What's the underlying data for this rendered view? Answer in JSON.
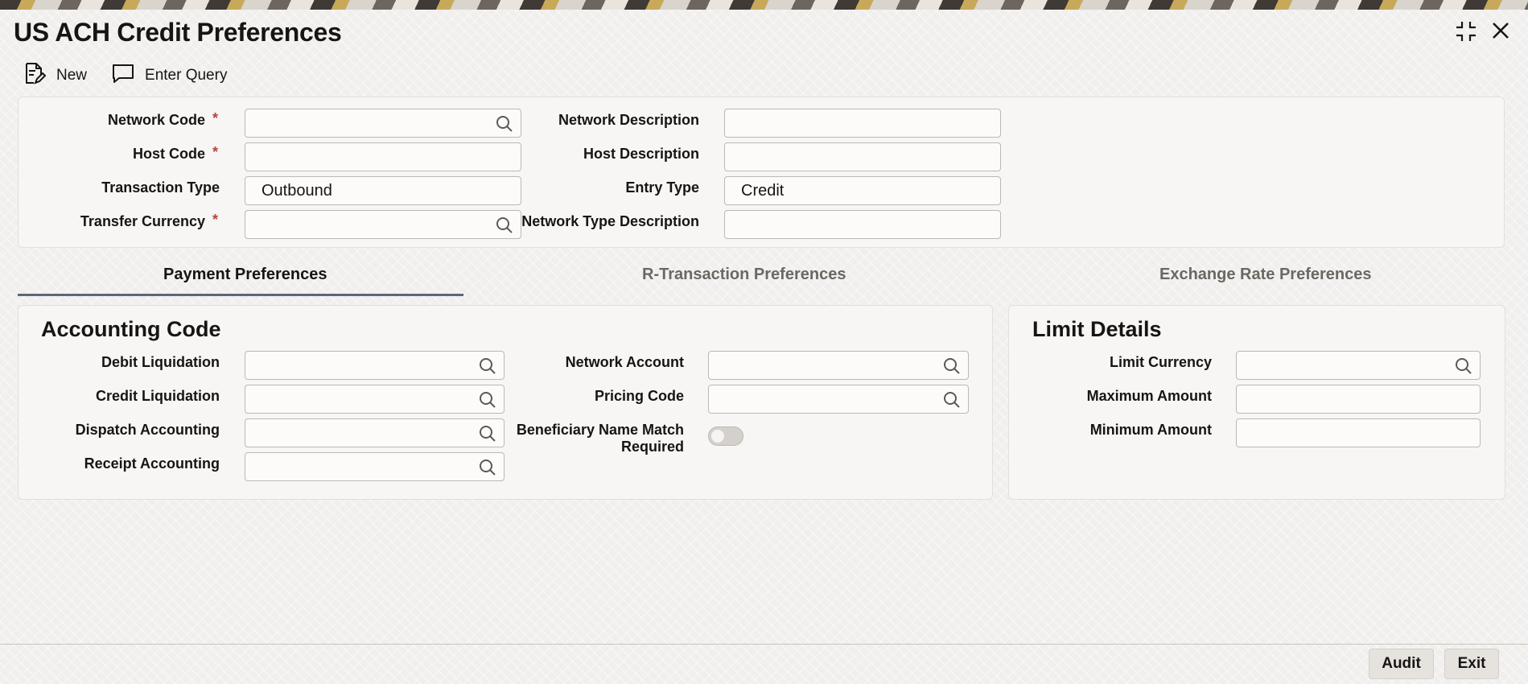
{
  "window": {
    "title": "US ACH Credit Preferences",
    "icons": [
      "fullscreen-collapse-icon",
      "close-icon"
    ]
  },
  "toolbar": {
    "new_label": "New",
    "enter_query_label": "Enter Query"
  },
  "header": {
    "network_code": {
      "label": "Network Code",
      "required_mark": "*",
      "value": ""
    },
    "host_code": {
      "label": "Host Code",
      "required_mark": "*",
      "value": ""
    },
    "transaction_type": {
      "label": "Transaction Type",
      "value": "Outbound"
    },
    "transfer_currency": {
      "label": "Transfer Currency",
      "required_mark": "*",
      "value": ""
    },
    "network_description": {
      "label": "Network Description",
      "value": ""
    },
    "host_description": {
      "label": "Host Description",
      "value": ""
    },
    "entry_type": {
      "label": "Entry Type",
      "value": "Credit"
    },
    "network_type_description": {
      "label": "Network Type Description",
      "value": ""
    }
  },
  "tabs": [
    {
      "label": "Payment Preferences",
      "active": true
    },
    {
      "label": "R-Transaction Preferences",
      "active": false
    },
    {
      "label": "Exchange Rate Preferences",
      "active": false
    }
  ],
  "accounting_code": {
    "title": "Accounting Code",
    "debit_liquidation": {
      "label": "Debit Liquidation",
      "value": ""
    },
    "credit_liquidation": {
      "label": "Credit Liquidation",
      "value": ""
    },
    "dispatch_accounting": {
      "label": "Dispatch Accounting",
      "value": ""
    },
    "receipt_accounting": {
      "label": "Receipt Accounting",
      "value": ""
    },
    "network_account": {
      "label": "Network Account",
      "value": ""
    },
    "pricing_code": {
      "label": "Pricing Code",
      "value": ""
    },
    "beneficiary_name_match": {
      "label_line1": "Beneficiary Name Match",
      "label_line2": "Required",
      "enabled": false
    }
  },
  "limit_details": {
    "title": "Limit Details",
    "limit_currency": {
      "label": "Limit Currency",
      "value": ""
    },
    "maximum_amount": {
      "label": "Maximum Amount",
      "value": ""
    },
    "minimum_amount": {
      "label": "Minimum Amount",
      "value": ""
    }
  },
  "footer": {
    "audit_label": "Audit",
    "exit_label": "Exit"
  },
  "colors": {
    "required": "#b8453a",
    "tab_underline": "#5b677a",
    "panel_bg": "#f7f6f4"
  }
}
